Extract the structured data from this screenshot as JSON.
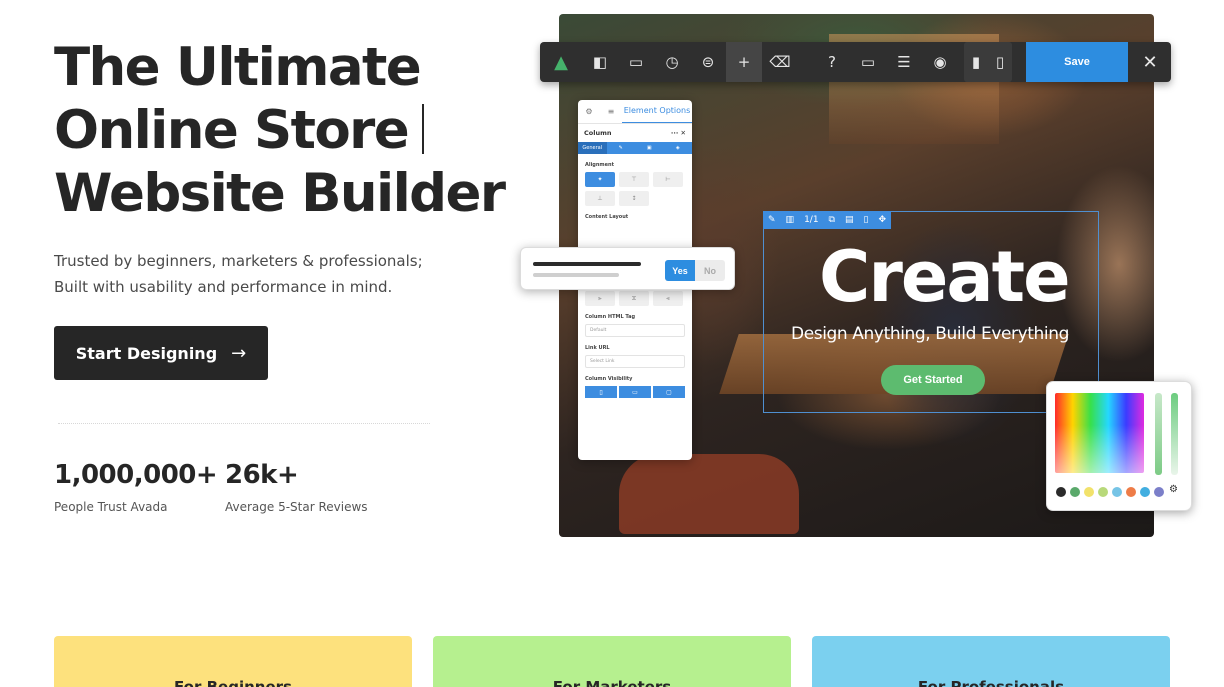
{
  "hero": {
    "title_line1": "The Ultimate",
    "title_line2": "Online Store",
    "title_line3": "Website Builder",
    "subtitle_line1": "Trusted by beginners, marketers & professionals;",
    "subtitle_line2": "Built with usability and performance in mind.",
    "cta_label": "Start Designing",
    "cta_icon": "arrow-right-icon"
  },
  "stats": [
    {
      "value": "1,000,000+",
      "label": "People Trust Avada"
    },
    {
      "value": "26k+",
      "label": "Average 5-Star Reviews"
    }
  ],
  "builder": {
    "toolbar": {
      "icons": [
        "avada-logo-icon",
        "sidebar-icon",
        "library-icon",
        "history-icon",
        "toggle-icon",
        "add-icon",
        "trash-icon",
        "help-icon",
        "desktop-icon",
        "layout-icon",
        "preview-icon",
        "page-icon",
        "page-outline-icon"
      ],
      "save_label": "Save",
      "close_icon": "close-icon"
    },
    "panel": {
      "tab_label": "Element Options",
      "title": "Column",
      "subtab_general": "General",
      "sections": {
        "alignment": "Alignment",
        "content_layout": "Content Layout",
        "html_tag": "Column HTML Tag",
        "html_tag_value": "Default",
        "link_url": "Link URL",
        "link_placeholder": "Select Link",
        "visibility": "Column Visibility"
      }
    },
    "toggle": {
      "yes": "Yes",
      "no": "No"
    },
    "mini_toolbar_label": "1/1",
    "preview": {
      "headline": "Create",
      "tagline": "Design Anything, Build Everything",
      "button": "Get Started"
    },
    "swatch_colors": [
      "#2b2b2b",
      "#5aa96b",
      "#f2e26b",
      "#b8d97a",
      "#76c4e6",
      "#ee7c47",
      "#42aee0",
      "#7b7fc9"
    ]
  },
  "cards": [
    {
      "label": "For Beginners",
      "color": "#fde17d"
    },
    {
      "label": "For Marketers",
      "color": "#b6f08f"
    },
    {
      "label": "For Professionals",
      "color": "#7bd0ef"
    }
  ],
  "colors": {
    "accent": "#2d8de0",
    "dark": "#262626",
    "success": "#5dbb6f"
  }
}
